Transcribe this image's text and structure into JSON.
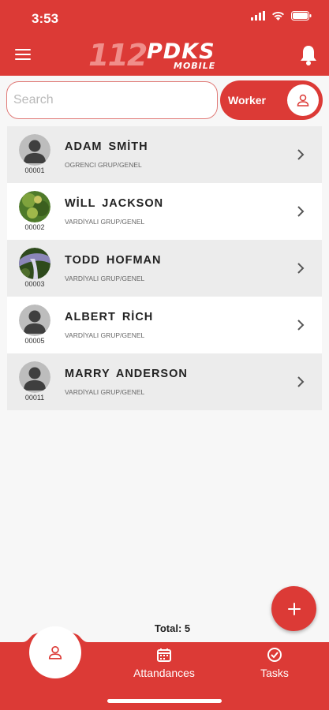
{
  "status_bar": {
    "time": "3:53"
  },
  "header": {
    "logo_number": "112",
    "logo_brand": "PDKS",
    "logo_sub": "MOBILE"
  },
  "search": {
    "placeholder": "Search",
    "value": ""
  },
  "filter_toggle": {
    "label": "Worker"
  },
  "workers": [
    {
      "id": "00001",
      "name": "ADAM SMİTH",
      "group": "OGRENCI GRUP/GENEL",
      "avatar": "placeholder"
    },
    {
      "id": "00002",
      "name": "WİLL JACKSON",
      "group": "VARDİYALI GRUP/GENEL",
      "avatar": "photo-green"
    },
    {
      "id": "00003",
      "name": "TODD HOFMAN",
      "group": "VARDİYALI GRUP/GENEL",
      "avatar": "photo-waterfall"
    },
    {
      "id": "00005",
      "name": "ALBERT RİCH",
      "group": "VARDİYALI GRUP/GENEL",
      "avatar": "placeholder"
    },
    {
      "id": "00011",
      "name": "MARRY ANDERSON",
      "group": "VARDİYALI GRUP/GENEL",
      "avatar": "placeholder"
    }
  ],
  "footer": {
    "total_label": "Total: 5"
  },
  "bottom_nav": {
    "attendances": "Attandances",
    "tasks": "Tasks"
  },
  "colors": {
    "accent": "#dc3a36",
    "row_shade": "#ececec"
  }
}
